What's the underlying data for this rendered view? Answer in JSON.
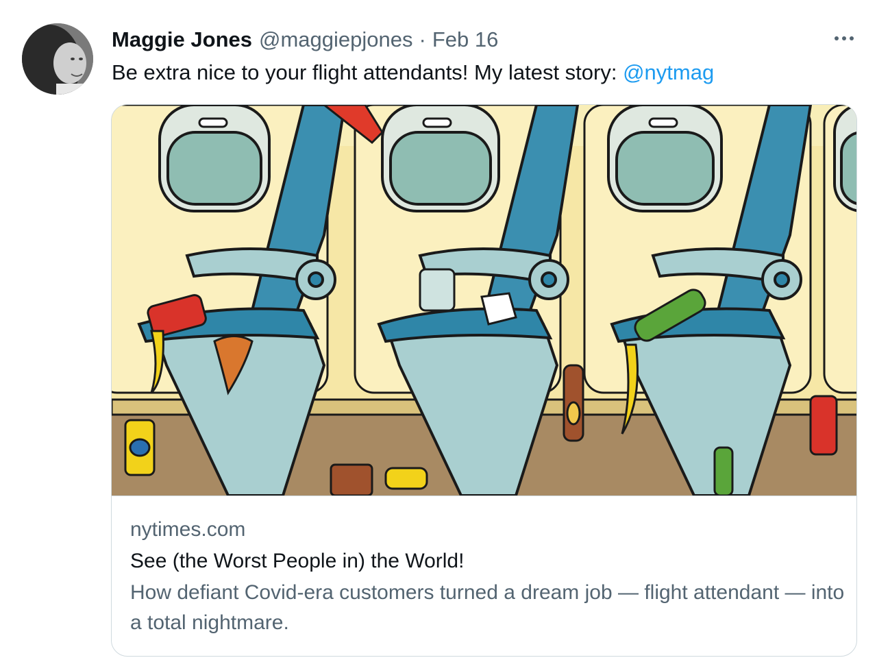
{
  "tweet": {
    "author_name": "Maggie Jones",
    "handle": "@maggiepjones",
    "separator": "·",
    "date": "Feb 16",
    "text": "Be extra nice to your flight attendants! My latest story: ",
    "mention": "@nytmag",
    "more_icon": "more-horizontal-icon"
  },
  "card": {
    "domain": "nytimes.com",
    "title": "See (the Worst People in) the World!",
    "description": "How defiant Covid-era customers turned a dream job — flight attendant — into a total nightmare."
  },
  "colors": {
    "accent": "#1d9bf0",
    "text_primary": "#0f1419",
    "text_secondary": "#536471",
    "card_border": "#cfd9de"
  }
}
